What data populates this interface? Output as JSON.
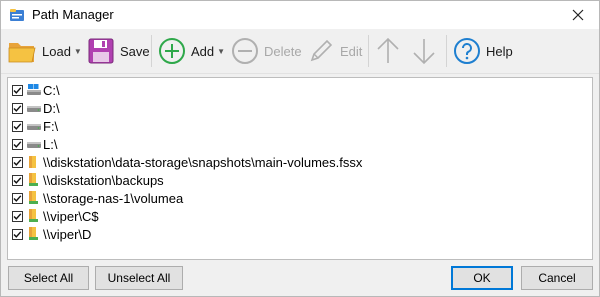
{
  "window": {
    "title": "Path Manager"
  },
  "toolbar": {
    "load_label": "Load",
    "save_label": "Save",
    "add_label": "Add",
    "delete_label": "Delete",
    "edit_label": "Edit",
    "help_label": "Help"
  },
  "paths": [
    {
      "label": "C:\\",
      "type": "drive",
      "checked": true
    },
    {
      "label": "D:\\",
      "type": "drive",
      "checked": true
    },
    {
      "label": "F:\\",
      "type": "drive",
      "checked": true
    },
    {
      "label": "L:\\",
      "type": "drive",
      "checked": true
    },
    {
      "label": "\\\\diskstation\\data-storage\\snapshots\\main-volumes.fssx",
      "type": "folder",
      "checked": true
    },
    {
      "label": "\\\\diskstation\\backups",
      "type": "folder-network",
      "checked": true
    },
    {
      "label": "\\\\storage-nas-1\\volumea",
      "type": "folder-network",
      "checked": true
    },
    {
      "label": "\\\\viper\\C$",
      "type": "folder-network",
      "checked": true
    },
    {
      "label": "\\\\viper\\D",
      "type": "folder-network",
      "checked": true
    }
  ],
  "buttons": {
    "select_all": "Select All",
    "unselect_all": "Unselect All",
    "ok": "OK",
    "cancel": "Cancel"
  },
  "colors": {
    "add_green": "#2ea84a",
    "help_blue": "#1e7fd0",
    "save_purple": "#b040b0",
    "folder_yellow": "#f5c242",
    "accent_blue": "#0078d7"
  }
}
